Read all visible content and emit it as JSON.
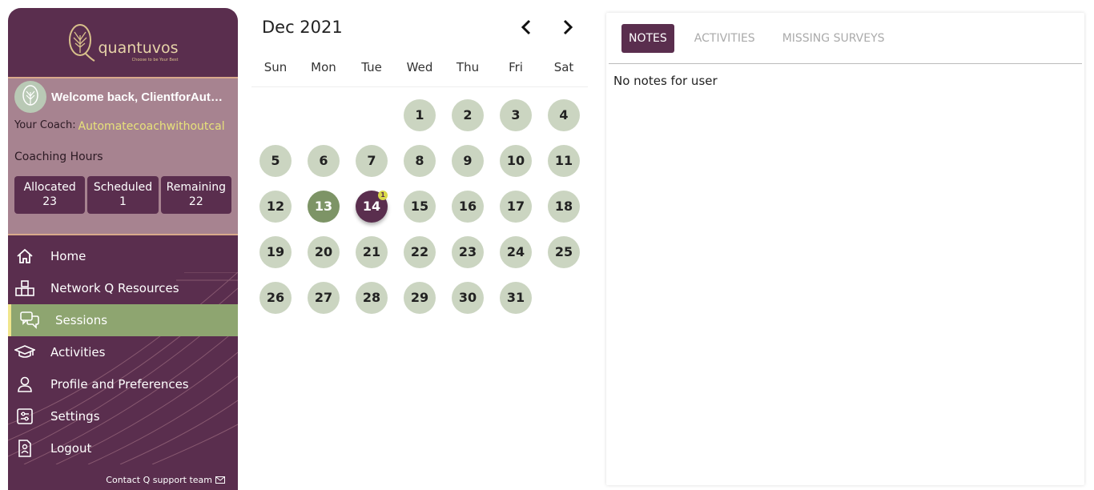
{
  "brand": {
    "name": "quantuvos",
    "tagline": "Choose to be Your Best"
  },
  "profile": {
    "welcome": "Welcome back, ClientforAuto...",
    "coach_label": "Your Coach:",
    "coach_name": "Automatecoachwithoutcal",
    "hours_title": "Coaching Hours",
    "hours": [
      {
        "label": "Allocated",
        "value": "23"
      },
      {
        "label": "Scheduled",
        "value": "1"
      },
      {
        "label": "Remaining",
        "value": "22"
      }
    ]
  },
  "nav": {
    "items": [
      {
        "label": "Home",
        "icon": "home-icon"
      },
      {
        "label": "Network Q Resources",
        "icon": "network-icon"
      },
      {
        "label": "Sessions",
        "icon": "chat-icon",
        "active": true
      },
      {
        "label": "Activities",
        "icon": "graduation-cap-icon"
      },
      {
        "label": "Profile and Preferences",
        "icon": "person-icon"
      },
      {
        "label": "Settings",
        "icon": "settings-icon"
      },
      {
        "label": "Logout",
        "icon": "logout-icon"
      }
    ],
    "support": "Contact Q support team"
  },
  "calendar": {
    "month": "Dec 2021",
    "weekdays": [
      "Sun",
      "Mon",
      "Tue",
      "Wed",
      "Thu",
      "Fri",
      "Sat"
    ],
    "first_weekday_index": 3,
    "days_in_month": 31,
    "today": 13,
    "selected": 14,
    "badges": {
      "14": "1"
    }
  },
  "panel": {
    "tabs": [
      {
        "label": "NOTES",
        "active": true
      },
      {
        "label": "ACTIVITIES"
      },
      {
        "label": "MISSING SURVEYS"
      }
    ],
    "empty_text": "No notes for user"
  },
  "colors": {
    "brand_purple": "#5a2e4e",
    "active_green": "#8ea570",
    "day_bg": "#cbd5c1",
    "accent_yellow": "#e7e27a"
  }
}
